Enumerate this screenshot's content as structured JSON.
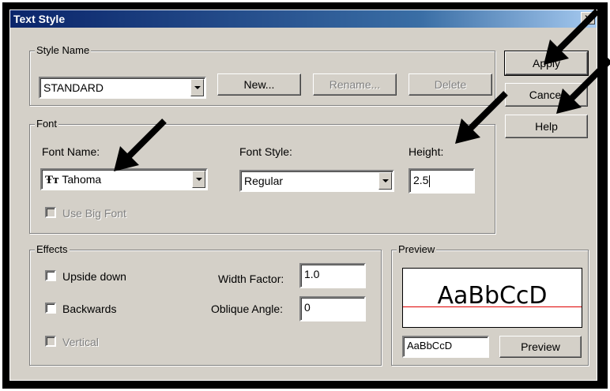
{
  "dialog": {
    "title": "Text Style",
    "close_glyph": "✕"
  },
  "style_name": {
    "group_label": "Style Name",
    "selected": "STANDARD",
    "new_label": "New...",
    "rename_label": "Rename...",
    "delete_label": "Delete"
  },
  "side_buttons": {
    "apply": "Apply",
    "cancel": "Cancel",
    "help": "Help"
  },
  "font": {
    "group_label": "Font",
    "font_name_label": "Font Name:",
    "font_name_value": "Tahoma",
    "font_icon": "truetype-font-icon",
    "font_style_label": "Font Style:",
    "font_style_value": "Regular",
    "height_label": "Height:",
    "height_value": "2.5",
    "use_big_font_label": "Use Big Font"
  },
  "effects": {
    "group_label": "Effects",
    "upside_down": "Upside down",
    "backwards": "Backwards",
    "vertical": "Vertical",
    "width_factor_label": "Width Factor:",
    "width_factor_value": "1.0",
    "oblique_label": "Oblique Angle:",
    "oblique_value": "0"
  },
  "preview": {
    "group_label": "Preview",
    "sample": "AaBbCcD",
    "input_value": "AaBbCcD",
    "button": "Preview"
  },
  "colors": {
    "title_start": "#0a246a",
    "face": "#d4d0c8",
    "baseline": "#e00000"
  }
}
